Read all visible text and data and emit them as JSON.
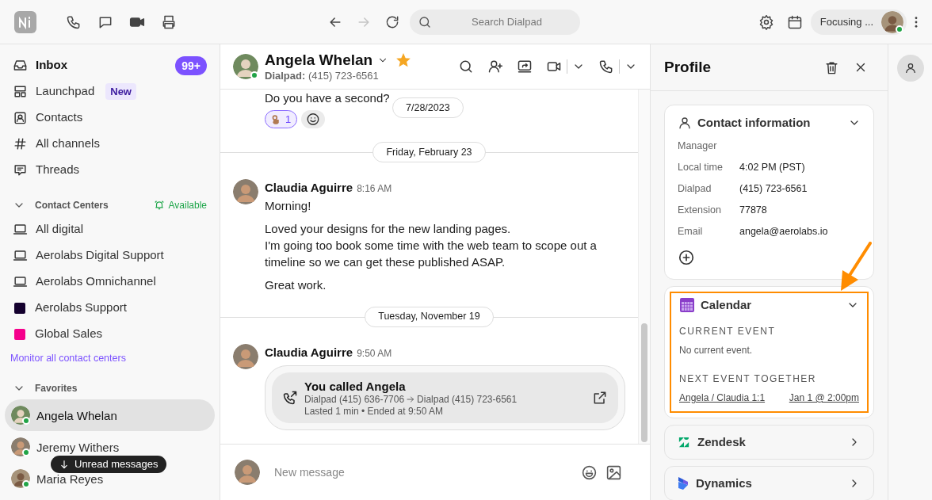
{
  "toolbar": {
    "nav": [
      {
        "kind": "back",
        "disabled": false
      },
      {
        "kind": "forward",
        "disabled": true
      },
      {
        "kind": "reload",
        "disabled": false
      }
    ],
    "search": {
      "placeholder": "Search Dialpad"
    },
    "status": {
      "label": "Focusing ...",
      "online": true
    }
  },
  "sidebar": {
    "items": [
      {
        "kind": "inbox",
        "label": "Inbox",
        "unread": true,
        "badge": "99+"
      },
      {
        "kind": "launchpad",
        "label": "Launchpad",
        "unread": false,
        "tag": "New"
      },
      {
        "kind": "contacts",
        "label": "Contacts",
        "unread": false
      },
      {
        "kind": "channels",
        "label": "All channels",
        "unread": false
      },
      {
        "kind": "threads",
        "label": "Threads",
        "unread": false
      }
    ],
    "contact_centers": {
      "title": "Contact Centers",
      "expanded": true,
      "availability": "Available",
      "items": [
        {
          "kind": "laptop",
          "label": "All digital"
        },
        {
          "kind": "laptop",
          "label": "Aerolabs Digital Support"
        },
        {
          "kind": "laptop",
          "label": "Aerolabs Omnichannel"
        },
        {
          "kind": "swatch",
          "label": "Aerolabs Support",
          "color": "#14002e"
        },
        {
          "kind": "swatch",
          "label": "Global Sales",
          "color": "#f5008c"
        }
      ],
      "link": "Monitor all contact centers"
    },
    "favorites": {
      "title": "Favorites",
      "expanded": true,
      "items": [
        {
          "label": "Angela Whelan",
          "selected": true,
          "online": true
        },
        {
          "label": "Jeremy Withers",
          "selected": false,
          "online": true
        },
        {
          "label": "Maria Reyes",
          "selected": false,
          "online": true
        }
      ]
    },
    "toast": "Unread messages"
  },
  "conversation": {
    "name": "Angela Whelan",
    "favorite": true,
    "online": true,
    "line_label": "Dialpad:",
    "number": "(415) 723-6561",
    "sticky_date": "7/28/2023",
    "feed": [
      {
        "kind": "text",
        "text": "Do you have a second?",
        "reactions": [
          {
            "count": "1",
            "mine": true
          }
        ]
      },
      {
        "kind": "divider",
        "label": "Friday, February 23"
      },
      {
        "kind": "message",
        "author": "Claudia Aguirre",
        "time": "8:16 AM",
        "paragraphs": [
          [
            "Morning!"
          ],
          [
            "Loved your designs for the new landing pages.",
            "I'm going too book some time with the web team to scope out a timeline so we can get these published ASAP."
          ],
          [
            "Great work."
          ]
        ]
      },
      {
        "kind": "divider",
        "label": "Tuesday, November 19"
      },
      {
        "kind": "call",
        "author": "Claudia Aguirre",
        "time": "9:50 AM",
        "title": "You called Angela",
        "from": "Dialpad (415) 636-7706",
        "to": "Dialpad (415) 723-6561",
        "detail": "Lasted 1 min • Ended at 9:50 AM"
      }
    ],
    "composer": {
      "placeholder": "New message"
    }
  },
  "profile": {
    "title": "Profile",
    "contact": {
      "title": "Contact information",
      "expanded": true,
      "fields": [
        {
          "label": "Manager"
        },
        {
          "label": "Local time",
          "value": "4:02 PM (PST)"
        },
        {
          "label": "Dialpad",
          "value": "(415) 723-6561"
        },
        {
          "label": "Extension",
          "value": "77878"
        },
        {
          "label": "Email",
          "value": "angela@aerolabs.io"
        }
      ]
    },
    "calendar": {
      "title": "Calendar",
      "expanded": true,
      "highlighted": true,
      "current_label": "CURRENT EVENT",
      "current_value": "No current event.",
      "next_label": "NEXT EVENT TOGETHER",
      "next_title": "Angela / Claudia 1:1",
      "next_when": "Jan 1 @ 2:00pm"
    },
    "integrations": [
      {
        "kind": "zendesk",
        "label": "Zendesk",
        "expanded": false
      },
      {
        "kind": "dynamics",
        "label": "Dynamics",
        "expanded": false
      }
    ]
  }
}
